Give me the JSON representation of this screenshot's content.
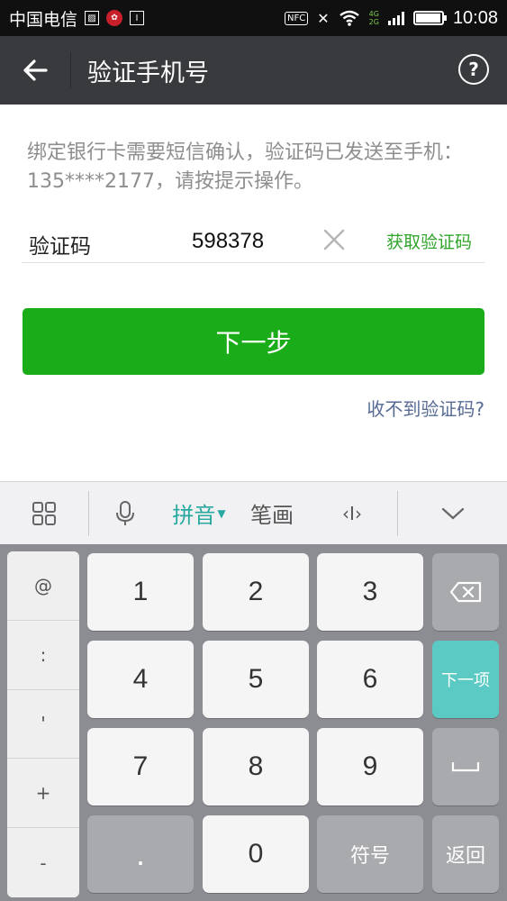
{
  "status_bar": {
    "carrier": "中国电信",
    "nfc": "NFC",
    "network": [
      "4G",
      "2G"
    ],
    "time": "10:08",
    "battery_level": 0.9
  },
  "header": {
    "title": "验证手机号",
    "back_icon": "back-arrow-icon",
    "help_icon": "help-icon",
    "help_label": "?"
  },
  "main": {
    "tip": "绑定银行卡需要短信确认，验证码已发送至手机：135****2177，请按提示操作。",
    "code_label": "验证码",
    "code_value": "598378",
    "get_code_label": "获取验证码",
    "next_label": "下一步",
    "no_code_label": "收不到验证码?"
  },
  "keyboard_toolbar": {
    "grid_icon": "grid-icon",
    "mic_icon": "microphone-icon",
    "pinyin_label": "拼音",
    "bihua_label": "笔画",
    "cursor_label": "‹I›",
    "collapse_icon": "chevron-down-icon"
  },
  "keyboard": {
    "symbols": [
      "@",
      ":",
      "'",
      "+",
      "-"
    ],
    "digits": [
      "1",
      "2",
      "3",
      "4",
      "5",
      "6",
      "7",
      "8",
      "9",
      "0"
    ],
    "dot": ".",
    "symbol_key": "符号",
    "next_field": "下一项",
    "return_key": "返回",
    "colors": {
      "accent_green": "#1aad19",
      "teal": "#5ccac4",
      "link_blue": "#576b95"
    }
  }
}
